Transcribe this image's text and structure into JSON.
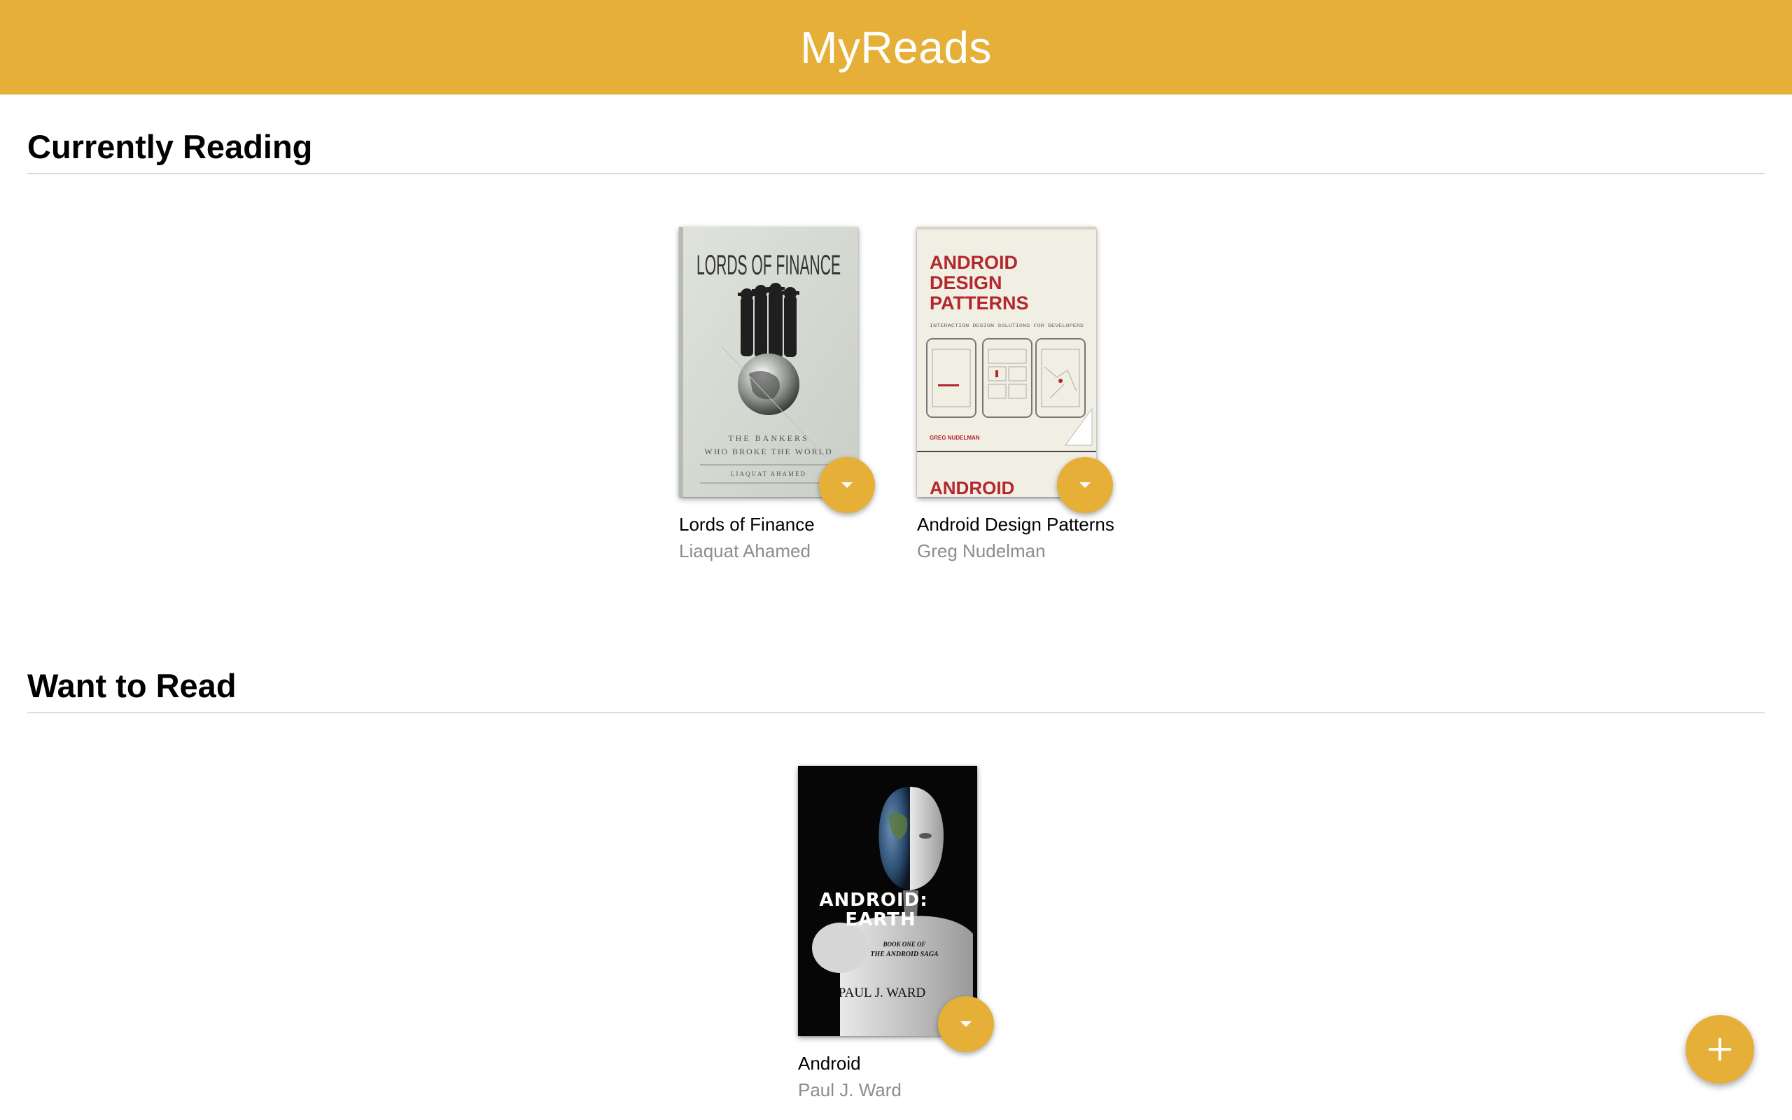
{
  "header": {
    "title": "MyReads"
  },
  "shelves": [
    {
      "title": "Currently Reading",
      "books": [
        {
          "title": "Lords of Finance",
          "author": "Liaquat Ahamed",
          "cover_text": {
            "main": "LORDS OF FINANCE",
            "sub1": "THE BANKERS",
            "sub2": "WHO BROKE THE WORLD",
            "author": "LIAQUAT AHAMED"
          }
        },
        {
          "title": "Android Design Patterns",
          "author": "Greg Nudelman",
          "cover_text": {
            "line1": "ANDROID",
            "line2": "DESIGN",
            "line3": "PATTERNS",
            "tagline": "INTERACTION DESIGN SOLUTIONS FOR DEVELOPERS",
            "author": "GREG NUDELMAN",
            "footer": "ANDROID"
          }
        }
      ]
    },
    {
      "title": "Want to Read",
      "books": [
        {
          "title": "Android",
          "author": "Paul J. Ward",
          "cover_text": {
            "line1": "ANDROID:",
            "line2": "EARTH",
            "sub1": "BOOK ONE OF",
            "sub2": "THE ANDROID SAGA",
            "author": "PAUL J. WARD"
          }
        }
      ]
    }
  ],
  "colors": {
    "accent": "#e6af37",
    "author_text": "#8c8c8c",
    "divider": "#dcdcdc"
  },
  "icons": {
    "shelf_changer": "caret-down-icon",
    "add": "plus-icon"
  }
}
